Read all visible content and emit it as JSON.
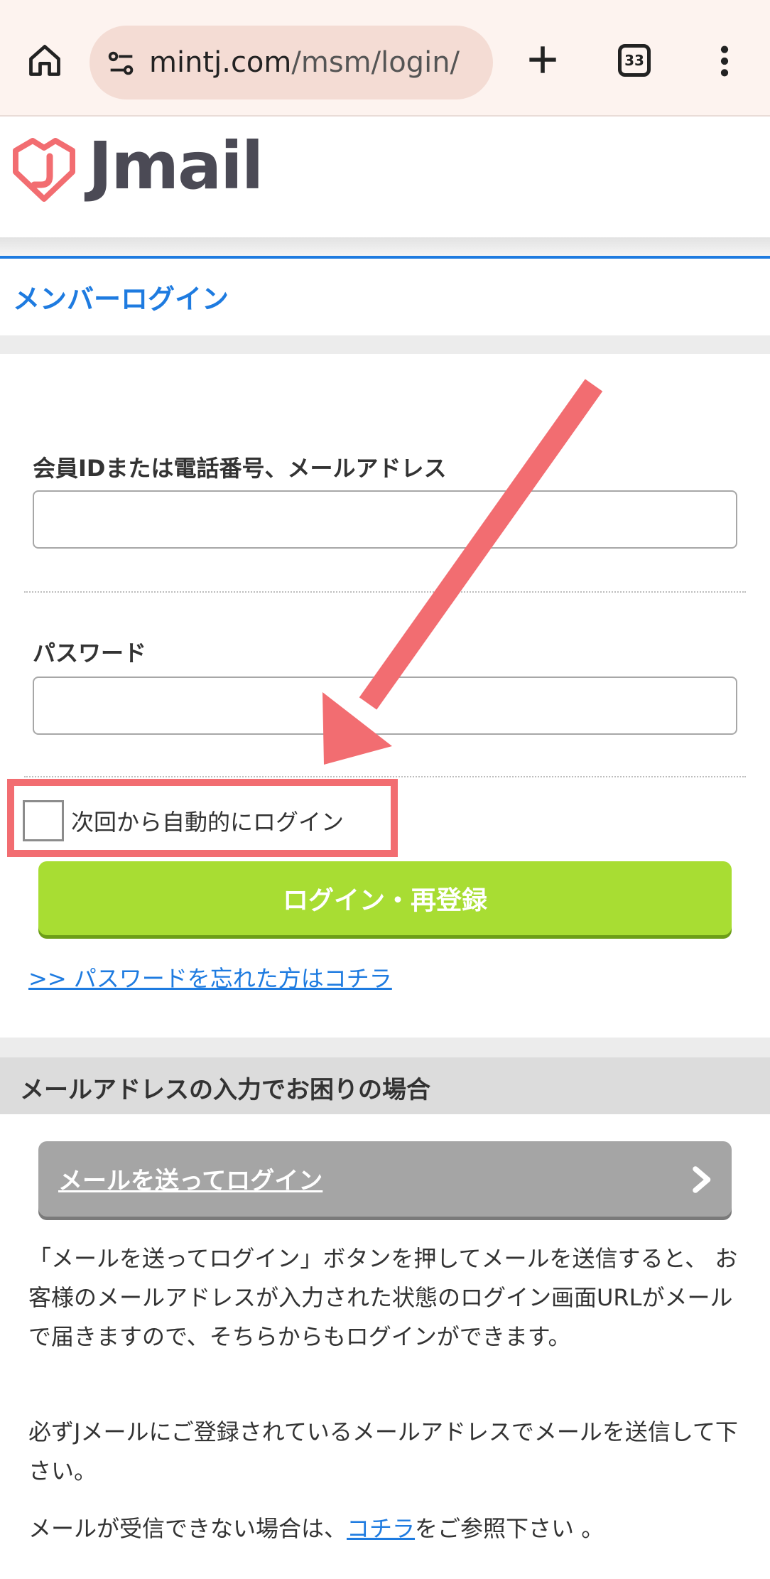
{
  "browser": {
    "url_domain": "mintj.com",
    "url_path": "/msm/login/",
    "tab_count": "33"
  },
  "header": {
    "logo_text": "Jmail",
    "brand_color": "#f26d71"
  },
  "page": {
    "title": "メンバーログイン",
    "accent_color": "#1e7be0"
  },
  "form": {
    "id_label": "会員IDまたは電話番号、メールアドレス",
    "id_value": "",
    "password_label": "パスワード",
    "password_value": "",
    "auto_login_label": "次回から自動的にログイン",
    "login_button": "ログイン・再登録",
    "forgot_link": ">> パスワードを忘れた方はコチラ"
  },
  "mail_section": {
    "title": "メールアドレスの入力でお困りの場合",
    "button": "メールを送ってログイン",
    "para1": "「メールを送ってログイン」ボタンを押してメールを送信すると、 お客様のメールアドレスが入力された状態のログイン画面URLがメールで届きますので、そちらからもログインができます。",
    "para2": "必ずJメールにご登録されているメールアドレスでメールを送信して下さい。",
    "para3_prefix": "メールが受信できない場合は、",
    "para3_link": "コチラ",
    "para3_suffix": "をご参照下さい 。"
  },
  "annotation": {
    "color": "#f26d71"
  }
}
